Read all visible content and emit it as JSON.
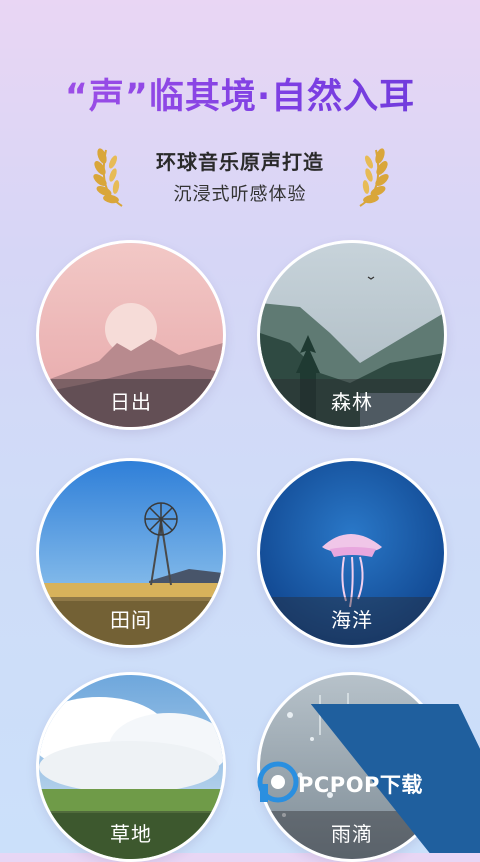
{
  "headline": "“声”临其境·自然入耳",
  "award": {
    "line1": "环球音乐原声打造",
    "line2": "沉浸式听感体验",
    "icon": "laurel-icon"
  },
  "scenes": [
    {
      "label": "日出"
    },
    {
      "label": "森林"
    },
    {
      "label": "田间"
    },
    {
      "label": "海洋"
    },
    {
      "label": "草地"
    },
    {
      "label": "雨滴"
    }
  ],
  "watermark": {
    "text": "PCPOP下载"
  },
  "colors": {
    "accent": "#8a3ee6",
    "laurel": "#d9a63a",
    "watermark": "#1f5f9e"
  }
}
